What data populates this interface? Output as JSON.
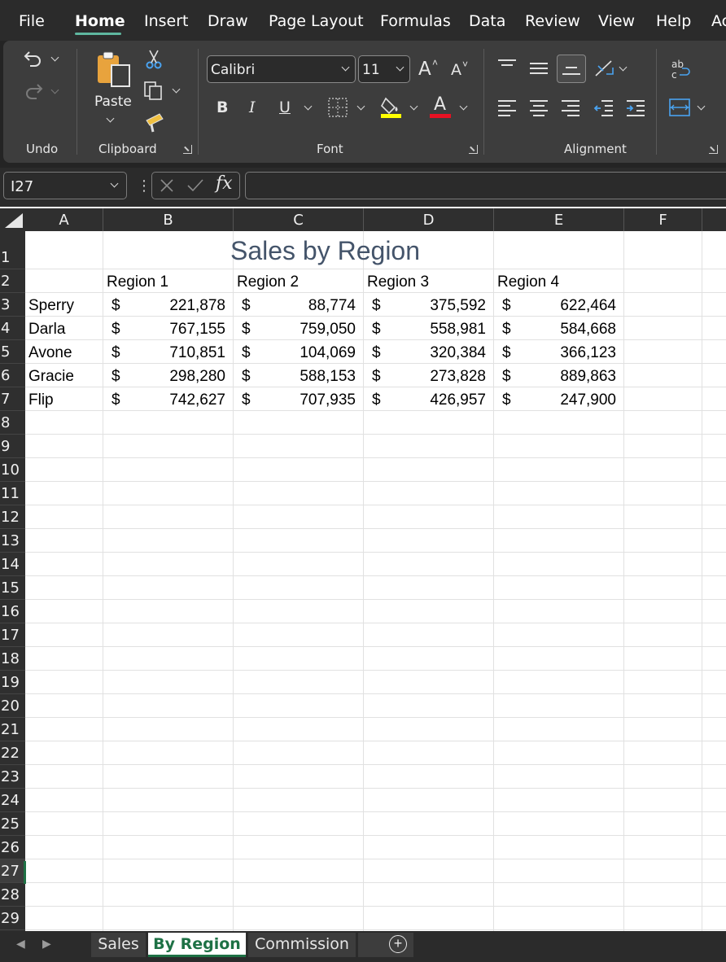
{
  "menu": {
    "items": [
      "File",
      "Home",
      "Insert",
      "Draw",
      "Page Layout",
      "Formulas",
      "Data",
      "Review",
      "View",
      "Help",
      "Ac"
    ],
    "active": "Home"
  },
  "ribbon": {
    "groups": {
      "undo": "Undo",
      "clipboard": "Clipboard",
      "font": "Font",
      "alignment": "Alignment"
    },
    "paste_label": "Paste",
    "font_name": "Calibri",
    "font_size": "11",
    "bold": "B",
    "italic": "I",
    "underline": "U",
    "grow_font": "A",
    "shrink_font": "A",
    "font_color_letter": "A",
    "colors": {
      "highlight": "#ffff00",
      "font_color": "#e81123"
    }
  },
  "formula_bar": {
    "name_box": "I27",
    "fx": "fx",
    "value": ""
  },
  "grid": {
    "columns": [
      "A",
      "B",
      "C",
      "D",
      "E",
      "F"
    ],
    "rows": [
      "1",
      "2",
      "3",
      "4",
      "5",
      "6",
      "7",
      "8",
      "9",
      "10",
      "11",
      "12",
      "13",
      "14",
      "15",
      "16",
      "17",
      "18",
      "19",
      "20",
      "21",
      "22",
      "23",
      "24",
      "25",
      "26",
      "27",
      "28",
      "29"
    ],
    "selected_row": "27",
    "title": "Sales by Region",
    "headers": [
      "Region 1",
      "Region 2",
      "Region 3",
      "Region 4"
    ],
    "currency": "$",
    "data": [
      {
        "name": "Sperry",
        "values": [
          "221,878",
          "88,774",
          "375,592",
          "622,464"
        ]
      },
      {
        "name": "Darla",
        "values": [
          "767,155",
          "759,050",
          "558,981",
          "584,668"
        ]
      },
      {
        "name": "Avone",
        "values": [
          "710,851",
          "104,069",
          "320,384",
          "366,123"
        ]
      },
      {
        "name": "Gracie",
        "values": [
          "298,280",
          "588,153",
          "273,828",
          "889,863"
        ]
      },
      {
        "name": "Flip",
        "values": [
          "742,627",
          "707,935",
          "426,957",
          "247,900"
        ]
      }
    ]
  },
  "sheets": {
    "tabs": [
      "Sales",
      "By Region",
      "Commission"
    ],
    "active": "By Region",
    "add_label": "+"
  }
}
